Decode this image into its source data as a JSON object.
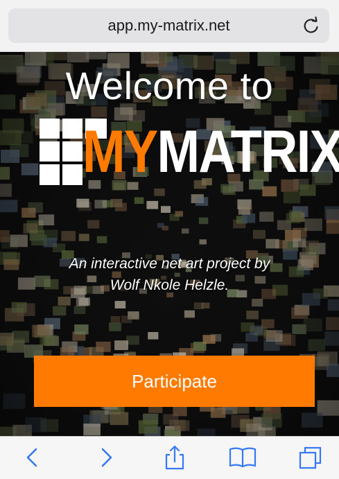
{
  "browser": {
    "url": "app.my-matrix.net"
  },
  "page": {
    "welcome_text": "Welcome to",
    "logo": {
      "my": "MY",
      "matrix": "MATRIX"
    },
    "tagline_line1": "An interactive net art project by",
    "tagline_line2": "Wolf Nkole Helzle.",
    "participate_label": "Participate"
  },
  "toolbar": {
    "icons": [
      "back-icon",
      "forward-icon",
      "share-icon",
      "bookmarks-icon",
      "tabs-icon"
    ]
  },
  "colors": {
    "accent": "#ff7a00",
    "ios_blue": "#3478f6",
    "background": "#0e0e0e"
  }
}
